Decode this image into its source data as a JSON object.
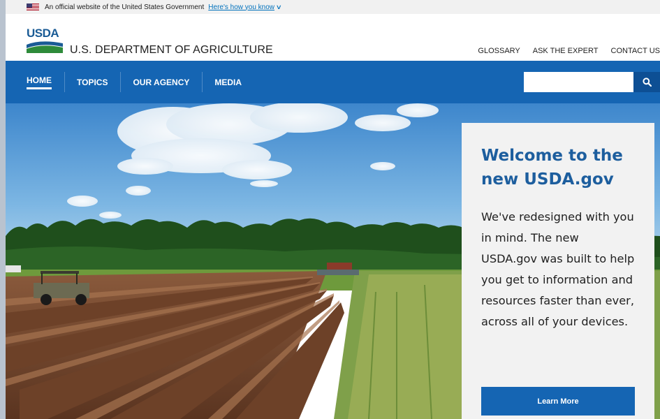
{
  "gov_banner": {
    "text": "An official website of the United States Government",
    "link": "Here's how you know",
    "flag_icon": "us-flag-icon"
  },
  "header": {
    "logo_text": "USDA",
    "department": "U.S. DEPARTMENT OF AGRICULTURE",
    "utility_links": [
      "GLOSSARY",
      "ASK THE EXPERT",
      "CONTACT US"
    ]
  },
  "nav": {
    "items": [
      {
        "label": "HOME",
        "active": true
      },
      {
        "label": "TOPICS",
        "active": false
      },
      {
        "label": "OUR AGENCY",
        "active": false
      },
      {
        "label": "MEDIA",
        "active": false
      }
    ],
    "search_placeholder": "",
    "search_icon": "search-icon"
  },
  "welcome": {
    "title": "Welcome to the new USDA.gov",
    "body": "We've redesigned with you in mind. The new USDA.gov was built to help you get to information and resources faster than ever, across all of your devices.",
    "button": "Learn More"
  },
  "colors": {
    "nav_blue": "#1565b3",
    "title_blue": "#1d5e9e",
    "link_blue": "#0071bc"
  }
}
